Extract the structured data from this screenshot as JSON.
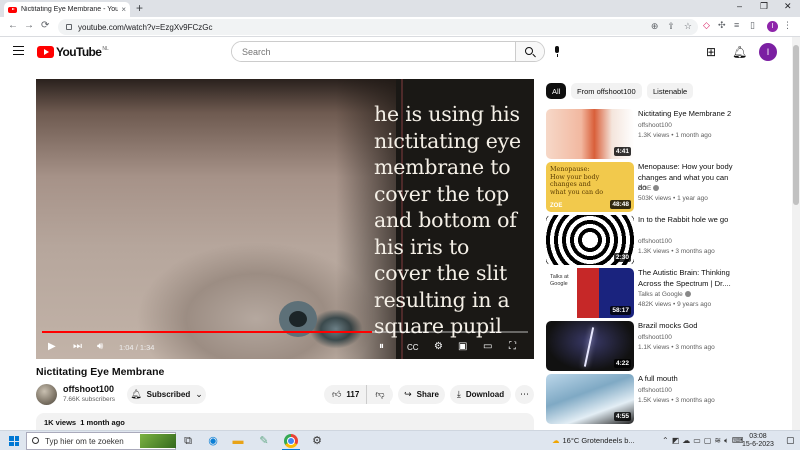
{
  "browser": {
    "tab_title": "Nictitating Eye Membrane - YouTube",
    "tab_close": "×",
    "new_tab": "+",
    "url": "youtube.com/watch?v=EzgXv9FCzGc",
    "profile_initial": "I",
    "window_controls": {
      "minimize": "–",
      "restore": "❐",
      "close": "✕"
    },
    "nav": {
      "back": "←",
      "forward": "→",
      "reload": "⟳"
    }
  },
  "header": {
    "logo_text": "YouTube",
    "country_code": "NL",
    "search_placeholder": "Search",
    "avatar_initial": "I"
  },
  "player": {
    "caption_lines": [
      "he is using his",
      "nictitating eye",
      "membrane to",
      "cover the top",
      "and bottom of",
      "his iris to",
      "cover the slit",
      "resulting in a",
      "square pupil"
    ],
    "time_current": "1:04",
    "time_total": "1:34",
    "progress_fraction": 0.68
  },
  "video": {
    "title": "Nictitating Eye Membrane",
    "channel": "offshoot100",
    "subscribers": "7.66K subscribers",
    "subscribe_label": "Subscribed",
    "likes": "117",
    "share_label": "Share",
    "download_label": "Download",
    "views": "1K views",
    "date": "1 month ago"
  },
  "chips": [
    "All",
    "From offshoot100",
    "Listenable"
  ],
  "recommendations": [
    {
      "title": "Nictitating Eye Membrane 2",
      "channel": "offshoot100",
      "views": "1.3K views",
      "age": "1 month ago",
      "duration": "4:41",
      "verified": false
    },
    {
      "title": "Menopause: How your body changes and what you can do",
      "channel": "ZOE",
      "views": "503K views",
      "age": "1 year ago",
      "duration": "48:48",
      "verified": true,
      "thumb_text": "Menopause: How your body changes and what you can do",
      "thumb_brand": "ZOE"
    },
    {
      "title": "In to the Rabbit hole we go",
      "channel": "offshoot100",
      "views": "1.3K views",
      "age": "3 months ago",
      "duration": "2:30",
      "verified": false
    },
    {
      "title": "The Autistic Brain: Thinking Across the Spectrum | Dr....",
      "channel": "Talks at Google",
      "views": "482K views",
      "age": "9 years ago",
      "duration": "58:17",
      "verified": true,
      "thumb_text": "Talks at Google"
    },
    {
      "title": "Brazil mocks God",
      "channel": "offshoot100",
      "views": "1.1K views",
      "age": "3 months ago",
      "duration": "4:22",
      "verified": false
    },
    {
      "title": "A full mouth",
      "channel": "offshoot100",
      "views": "1.5K views",
      "age": "3 months ago",
      "duration": "4:55",
      "verified": false
    }
  ],
  "taskbar": {
    "search_placeholder": "Typ hier om te zoeken",
    "weather": "16°C  Grotendeels b...",
    "time": "03:08",
    "date": "15-6-2023"
  },
  "colors": {
    "yt_red": "#ff0000",
    "progress": "#ff0000",
    "avatar": "#7b1fa2"
  }
}
